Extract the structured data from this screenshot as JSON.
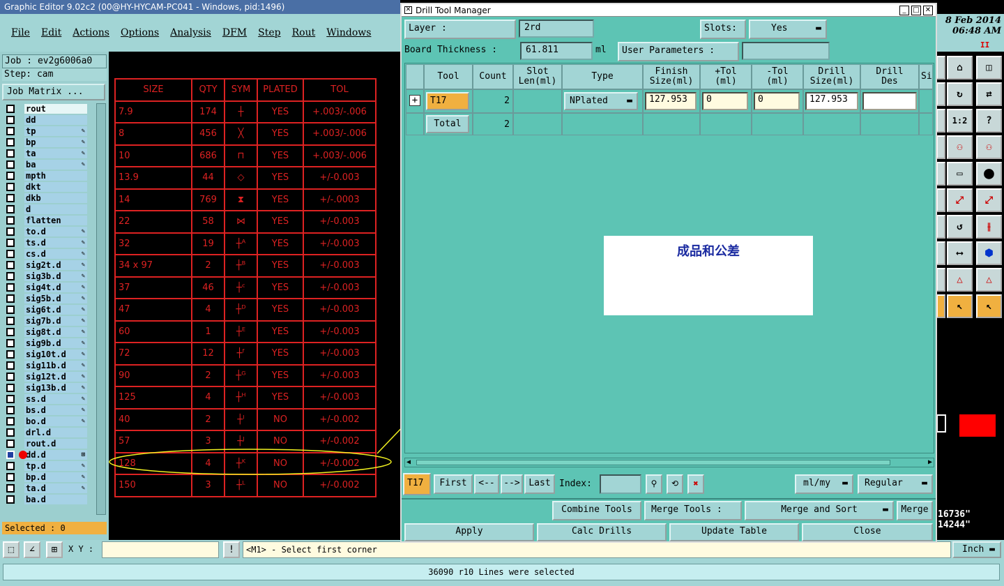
{
  "app": {
    "title": "Graphic Editor 9.02c2 (00@HY-HYCAM-PC041 - Windows, pid:1496)",
    "menu": [
      "File",
      "Edit",
      "Actions",
      "Options",
      "Analysis",
      "DFM",
      "Step",
      "Rout",
      "Windows"
    ],
    "date": "8 Feb 2014",
    "time": "06:48 AM",
    "indicator": "II"
  },
  "left": {
    "job": "Job : ev2g6006a0",
    "step": "Step: cam",
    "job_matrix": "Job Matrix ...",
    "layers": [
      {
        "name": "rout",
        "mark": "",
        "highlight": true
      },
      {
        "name": "dd",
        "mark": ""
      },
      {
        "name": "tp",
        "mark": "✎"
      },
      {
        "name": "bp",
        "mark": "✎"
      },
      {
        "name": "ta",
        "mark": "✎"
      },
      {
        "name": "ba",
        "mark": "✎"
      },
      {
        "name": "mpth",
        "mark": ""
      },
      {
        "name": "dkt",
        "mark": ""
      },
      {
        "name": "dkb",
        "mark": ""
      },
      {
        "name": "d",
        "mark": ""
      },
      {
        "name": "flatten",
        "mark": ""
      },
      {
        "name": "to.d",
        "mark": "✎"
      },
      {
        "name": "ts.d",
        "mark": "✎"
      },
      {
        "name": "cs.d",
        "mark": "✎"
      },
      {
        "name": "sig2t.d",
        "mark": "✎"
      },
      {
        "name": "sig3b.d",
        "mark": "✎"
      },
      {
        "name": "sig4t.d",
        "mark": "✎"
      },
      {
        "name": "sig5b.d",
        "mark": "✎"
      },
      {
        "name": "sig6t.d",
        "mark": "✎"
      },
      {
        "name": "sig7b.d",
        "mark": "✎"
      },
      {
        "name": "sig8t.d",
        "mark": "✎"
      },
      {
        "name": "sig9b.d",
        "mark": "✎"
      },
      {
        "name": "sig10t.d",
        "mark": "✎"
      },
      {
        "name": "sig11b.d",
        "mark": "✎"
      },
      {
        "name": "sig12t.d",
        "mark": "✎"
      },
      {
        "name": "sig13b.d",
        "mark": "✎"
      },
      {
        "name": "ss.d",
        "mark": "✎"
      },
      {
        "name": "bs.d",
        "mark": "✎"
      },
      {
        "name": "bo.d",
        "mark": "✎"
      },
      {
        "name": "drl.d",
        "mark": ""
      },
      {
        "name": "rout.d",
        "mark": ""
      },
      {
        "name": "dd.d",
        "mark": "⊞",
        "active": true
      },
      {
        "name": "tp.d",
        "mark": "✎"
      },
      {
        "name": "bp.d",
        "mark": "✎"
      },
      {
        "name": "ta.d",
        "mark": "✎"
      },
      {
        "name": "ba.d",
        "mark": ""
      }
    ],
    "selected": "Selected : 0"
  },
  "drill_table": {
    "headers": [
      "SIZE",
      "QTY",
      "SYM",
      "PLATED",
      "TOL"
    ],
    "rows": [
      [
        "7.9",
        "174",
        "┼",
        "YES",
        "+.003/-.006"
      ],
      [
        "8",
        "456",
        "╳",
        "YES",
        "+.003/-.006"
      ],
      [
        "10",
        "686",
        "⊓",
        "YES",
        "+.003/-.006"
      ],
      [
        "13.9",
        "44",
        "◇",
        "YES",
        "+/-0.003"
      ],
      [
        "14",
        "769",
        "⧗",
        "YES",
        "+/-.0003"
      ],
      [
        "22",
        "58",
        "⋈",
        "YES",
        "+/-0.003"
      ],
      [
        "32",
        "19",
        "┼ᴬ",
        "YES",
        "+/-0.003"
      ],
      [
        "34 x 97",
        "2",
        "┼ᴮ",
        "YES",
        "+/-0.003"
      ],
      [
        "37",
        "46",
        "┼ᶜ",
        "YES",
        "+/-0.003"
      ],
      [
        "47",
        "4",
        "┼ᴰ",
        "YES",
        "+/-0.003"
      ],
      [
        "60",
        "1",
        "┼ᴱ",
        "YES",
        "+/-0.003"
      ],
      [
        "72",
        "12",
        "┼ᶠ",
        "YES",
        "+/-0.003"
      ],
      [
        "90",
        "2",
        "┼ᴳ",
        "YES",
        "+/-0.003"
      ],
      [
        "125",
        "4",
        "┼ᴴ",
        "YES",
        "+/-0.003"
      ],
      [
        "40",
        "2",
        "┼ᴵ",
        "NO",
        "+/-0.002"
      ],
      [
        "57",
        "3",
        "┼ᴶ",
        "NO",
        "+/-0.002"
      ],
      [
        "128",
        "4",
        "┼ᴷ",
        "NO",
        "+/-0.002"
      ],
      [
        "150",
        "3",
        "┼ᴸ",
        "NO",
        "+/-0.002"
      ]
    ]
  },
  "dialog": {
    "title": "Drill Tool Manager",
    "layer_label": "Layer          :",
    "layer_value": "2rd",
    "slots_label": "Slots:",
    "slots_value": "Yes",
    "board_label": "Board Thickness :",
    "board_value": "61.811",
    "board_unit": "ml",
    "user_params": "User Parameters :",
    "columns": [
      "Tool",
      "Count",
      "Slot Len(ml)",
      "Type",
      "Finish Size(ml)",
      "+Tol (ml)",
      "-Tol (ml)",
      "Drill Size(ml)",
      "Drill Des",
      "Si"
    ],
    "row": {
      "tool": "T17",
      "count": "2",
      "type": "NPlated",
      "finish": "127.953",
      "plus_tol": "0",
      "minus_tol": "0",
      "drill_size": "127.953",
      "drill_des": ""
    },
    "total": {
      "label": "Total",
      "count": "2"
    },
    "callout": "成品和公差",
    "nav": {
      "current": "T17",
      "first": "First",
      "prev": "<--",
      "next": "-->",
      "last": "Last",
      "index_label": "Index:",
      "units": "ml/my",
      "mode": "Regular"
    },
    "combine": "Combine Tools",
    "merge_label": "Merge Tools :",
    "merge_value": "Merge and Sort",
    "merge_btn": "Merge",
    "apply": "Apply",
    "calc": "Calc Drills",
    "update": "Update Table",
    "close": "Close"
  },
  "bottom": {
    "xy_label": "X Y :",
    "prompt": "<M1> - Select first corner",
    "units": "Inch",
    "status": "36090 r10 Lines were selected",
    "coord1": "16736\"",
    "coord2": "14244\""
  },
  "colors": {
    "drawing_red": "#dd2222",
    "panel": "#a2d5d5",
    "dialog_bg": "#5dc4b4",
    "callout_text": "#1a2aa0",
    "annotation": "#f0f020"
  }
}
